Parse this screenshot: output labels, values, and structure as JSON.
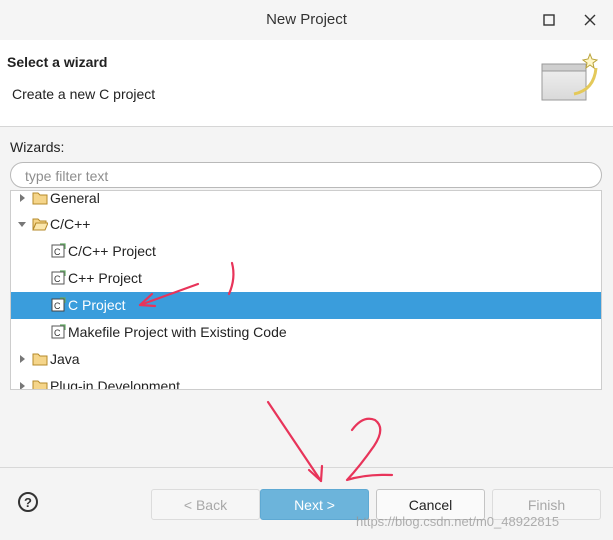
{
  "window": {
    "title": "New Project",
    "maximize_glyph": "☐",
    "close_glyph": "✕"
  },
  "header": {
    "title": "Select a wizard",
    "subtitle": "Create a new C project"
  },
  "wizards": {
    "label": "Wizards:",
    "filter_placeholder": "type filter text",
    "filter_value": ""
  },
  "tree": {
    "items": [
      {
        "label": "General",
        "type": "folder",
        "expanded": false
      },
      {
        "label": "C/C++",
        "type": "folder",
        "expanded": true
      },
      {
        "label": "C/C++ Project",
        "type": "project"
      },
      {
        "label": "C++ Project",
        "type": "project"
      },
      {
        "label": "C Project",
        "type": "project",
        "selected": true
      },
      {
        "label": "Makefile Project with Existing Code",
        "type": "project"
      },
      {
        "label": "Java",
        "type": "folder",
        "expanded": false
      },
      {
        "label": "Plug-in Development",
        "type": "folder",
        "expanded": false
      }
    ]
  },
  "buttons": {
    "help": "?",
    "back": "< Back",
    "next": "Next >",
    "cancel": "Cancel",
    "finish": "Finish"
  },
  "watermark": "https://blog.csdn.net/m0_48922815",
  "colors": {
    "selection": "#3a9ddc",
    "primary_button": "#6cb4db",
    "annotation": "#e8345a"
  },
  "icons": {
    "folder": "folder-icon",
    "project": "c-project-icon",
    "help": "help-icon",
    "banner": "wizard-banner-icon"
  }
}
